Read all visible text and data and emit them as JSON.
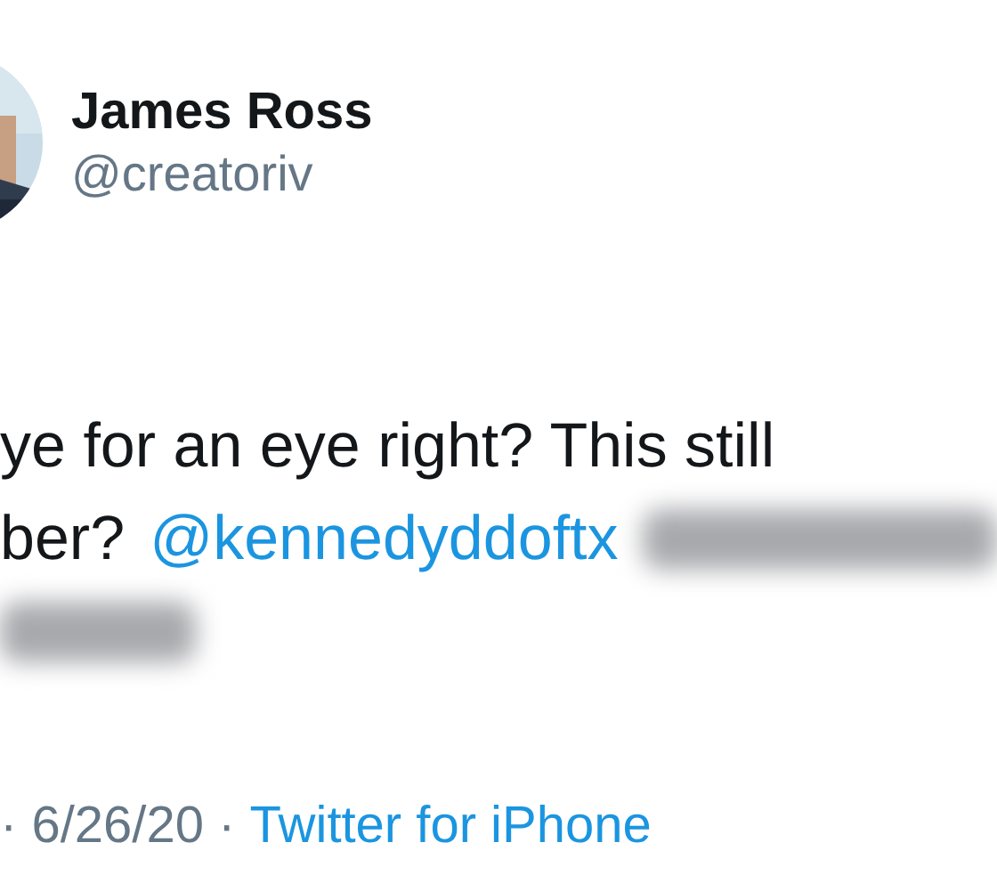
{
  "author": {
    "name": "James Ross",
    "handle": "@creatoriv"
  },
  "tweet": {
    "lines": [
      {
        "text": "ye for an eye right? This still",
        "redacted": false
      },
      {
        "text": "ber?",
        "mention": "@kennedyddoftx",
        "redacted": true
      }
    ],
    "redacted_tail": true
  },
  "meta": {
    "date": "· 6/26/20 ·",
    "source": "Twitter for iPhone"
  }
}
